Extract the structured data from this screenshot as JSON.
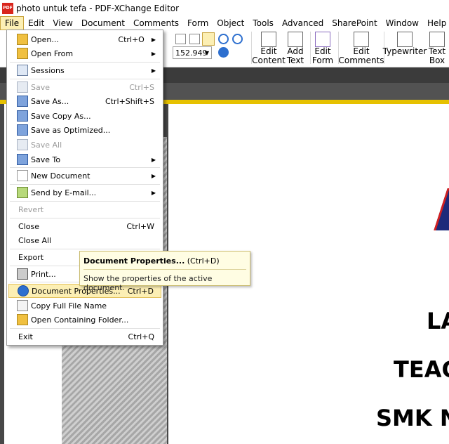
{
  "window": {
    "app_icon": "pdf-xchange-icon",
    "app_icon_text": "PDF",
    "title": "photo untuk tefa - PDF-XChange Editor"
  },
  "menubar": [
    {
      "label": "File"
    },
    {
      "label": "Edit"
    },
    {
      "label": "View"
    },
    {
      "label": "Document"
    },
    {
      "label": "Comments"
    },
    {
      "label": "Form"
    },
    {
      "label": "Object"
    },
    {
      "label": "Tools"
    },
    {
      "label": "Advanced"
    },
    {
      "label": "SharePoint"
    },
    {
      "label": "Window"
    },
    {
      "label": "Help"
    }
  ],
  "ribbon": {
    "zoom_value": "152.949",
    "buttons": [
      {
        "line1": "Edit",
        "line2": "Content",
        "icon": "edit-content-icon"
      },
      {
        "line1": "Add",
        "line2": "Text",
        "icon": "add-text-icon"
      },
      {
        "line1": "Edit",
        "line2": "Form",
        "icon": "edit-form-icon"
      },
      {
        "line1": "Edit",
        "line2": "Comments",
        "icon": "edit-comments-icon"
      },
      {
        "line1": "Typewriter",
        "line2": "",
        "icon": "typewriter-icon"
      },
      {
        "line1": "Text",
        "line2": "Box",
        "icon": "text-box-icon"
      }
    ]
  },
  "file_menu": {
    "items": [
      {
        "label": "Open...",
        "shortcut": "Ctrl+O",
        "submenu": true,
        "disabled": false,
        "icon": "open-folder-icon"
      },
      {
        "label": "Open From",
        "shortcut": "",
        "submenu": true,
        "disabled": false,
        "icon": "open-from-icon"
      },
      {
        "label": "Sessions",
        "shortcut": "",
        "submenu": true,
        "disabled": false,
        "icon": "sessions-icon"
      },
      {
        "label": "Save",
        "shortcut": "Ctrl+S",
        "submenu": false,
        "disabled": true,
        "icon": "save-icon"
      },
      {
        "label": "Save As...",
        "shortcut": "Ctrl+Shift+S",
        "submenu": false,
        "disabled": false,
        "icon": "save-as-icon"
      },
      {
        "label": "Save Copy As...",
        "shortcut": "",
        "submenu": false,
        "disabled": false,
        "icon": "save-copy-icon"
      },
      {
        "label": "Save as Optimized...",
        "shortcut": "",
        "submenu": false,
        "disabled": false,
        "icon": "save-optimized-icon"
      },
      {
        "label": "Save All",
        "shortcut": "",
        "submenu": false,
        "disabled": true,
        "icon": "save-all-icon"
      },
      {
        "label": "Save To",
        "shortcut": "",
        "submenu": true,
        "disabled": false,
        "icon": "save-to-icon"
      },
      {
        "label": "New Document",
        "shortcut": "",
        "submenu": true,
        "disabled": false,
        "icon": "new-document-icon"
      },
      {
        "label": "Send by E-mail...",
        "shortcut": "",
        "submenu": true,
        "disabled": false,
        "icon": "email-icon"
      },
      {
        "label": "Revert",
        "shortcut": "",
        "submenu": false,
        "disabled": true,
        "icon": ""
      },
      {
        "label": "Close",
        "shortcut": "Ctrl+W",
        "submenu": false,
        "disabled": false,
        "icon": ""
      },
      {
        "label": "Close All",
        "shortcut": "",
        "submenu": false,
        "disabled": false,
        "icon": ""
      },
      {
        "label": "Export",
        "shortcut": "",
        "submenu": true,
        "disabled": false,
        "icon": ""
      },
      {
        "label": "Print...",
        "shortcut": "",
        "submenu": false,
        "disabled": false,
        "icon": "printer-icon"
      },
      {
        "label": "Document Properties...",
        "shortcut": "Ctrl+D",
        "submenu": false,
        "disabled": false,
        "icon": "info-icon",
        "highlighted": true
      },
      {
        "label": "Copy Full File Name",
        "shortcut": "",
        "submenu": false,
        "disabled": false,
        "icon": "copy-icon"
      },
      {
        "label": "Open Containing Folder...",
        "shortcut": "",
        "submenu": false,
        "disabled": false,
        "icon": "folder-icon"
      },
      {
        "label": "Exit",
        "shortcut": "Ctrl+Q",
        "submenu": false,
        "disabled": false,
        "icon": ""
      }
    ]
  },
  "tooltip": {
    "title": "Document Properties...",
    "shortcut": "(Ctrl+D)",
    "description": "Show the properties of the active document."
  },
  "document": {
    "line1": "LA",
    "line2": "TEAC",
    "line3": "SMK N"
  },
  "colors": {
    "highlight": "#fcefb4",
    "menu_active": "#fcefb4",
    "page_top_strip": "#e6c100",
    "app_icon_bg": "#d9251d"
  }
}
